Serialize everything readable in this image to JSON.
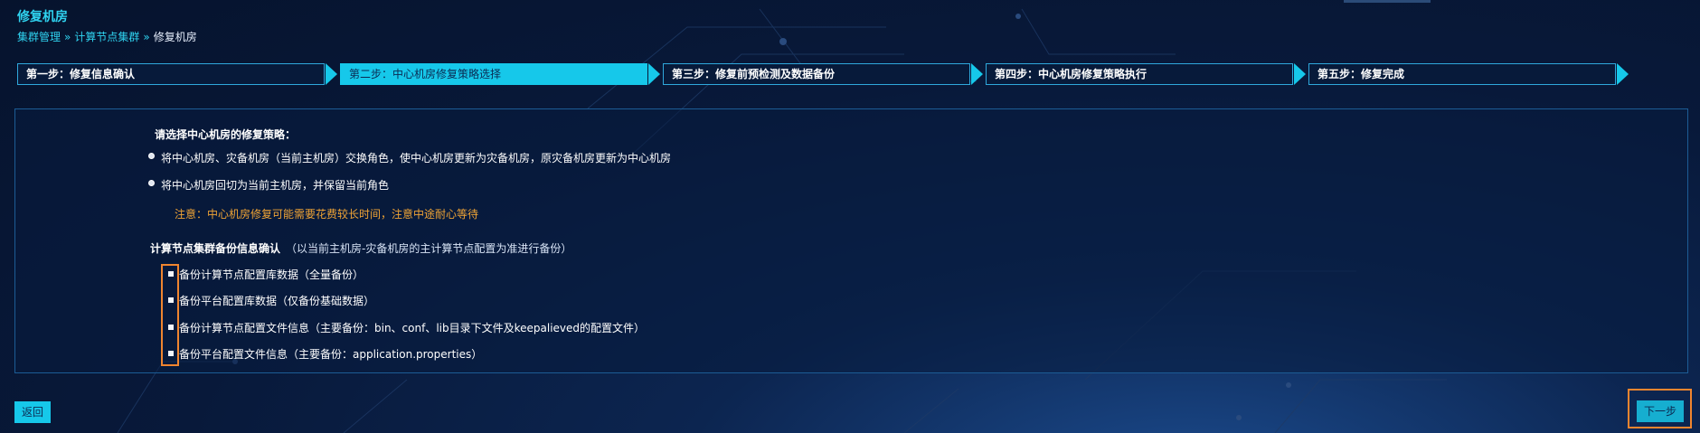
{
  "page": {
    "title": "修复机房",
    "breadcrumb": [
      {
        "label": "集群管理"
      },
      {
        "label": "计算节点集群"
      },
      {
        "label": "修复机房"
      }
    ],
    "breadcrumb_sep": "»"
  },
  "steps": [
    {
      "label": "第一步：修复信息确认",
      "active": false
    },
    {
      "label": "第二步：中心机房修复策略选择",
      "active": true
    },
    {
      "label": "第三步：修复前预检测及数据备份",
      "active": false
    },
    {
      "label": "第四步：中心机房修复策略执行",
      "active": false
    },
    {
      "label": "第五步：修复完成",
      "active": false
    }
  ],
  "strategy": {
    "heading": "请选择中心机房的修复策略：",
    "options": [
      {
        "label": "将中心机房、灾备机房（当前主机房）交换角色，使中心机房更新为灾备机房，原灾备机房更新为中心机房"
      },
      {
        "label": "将中心机房回切为当前主机房，并保留当前角色"
      }
    ],
    "warning": "注意：中心机房修复可能需要花费较长时间，注意中途耐心等待"
  },
  "backup": {
    "heading": "计算节点集群备份信息确认",
    "note": "（以当前主机房-灾备机房的主计算节点配置为准进行备份）",
    "items": [
      {
        "label": "备份计算节点配置库数据（全量备份）"
      },
      {
        "label": "备份平台配置库数据（仅备份基础数据）"
      },
      {
        "label": "备份计算节点配置文件信息（主要备份：bin、conf、lib目录下文件及keepalieved的配置文件）"
      },
      {
        "label": "备份平台配置文件信息（主要备份：application.properties）"
      }
    ]
  },
  "actions": {
    "back_label": "返回",
    "next_label": "下一步"
  },
  "colors": {
    "accent": "#16c8ea",
    "title": "#2fd3f0",
    "warning": "#f0a435",
    "highlight": "#f0852f",
    "background": "#08193a"
  }
}
